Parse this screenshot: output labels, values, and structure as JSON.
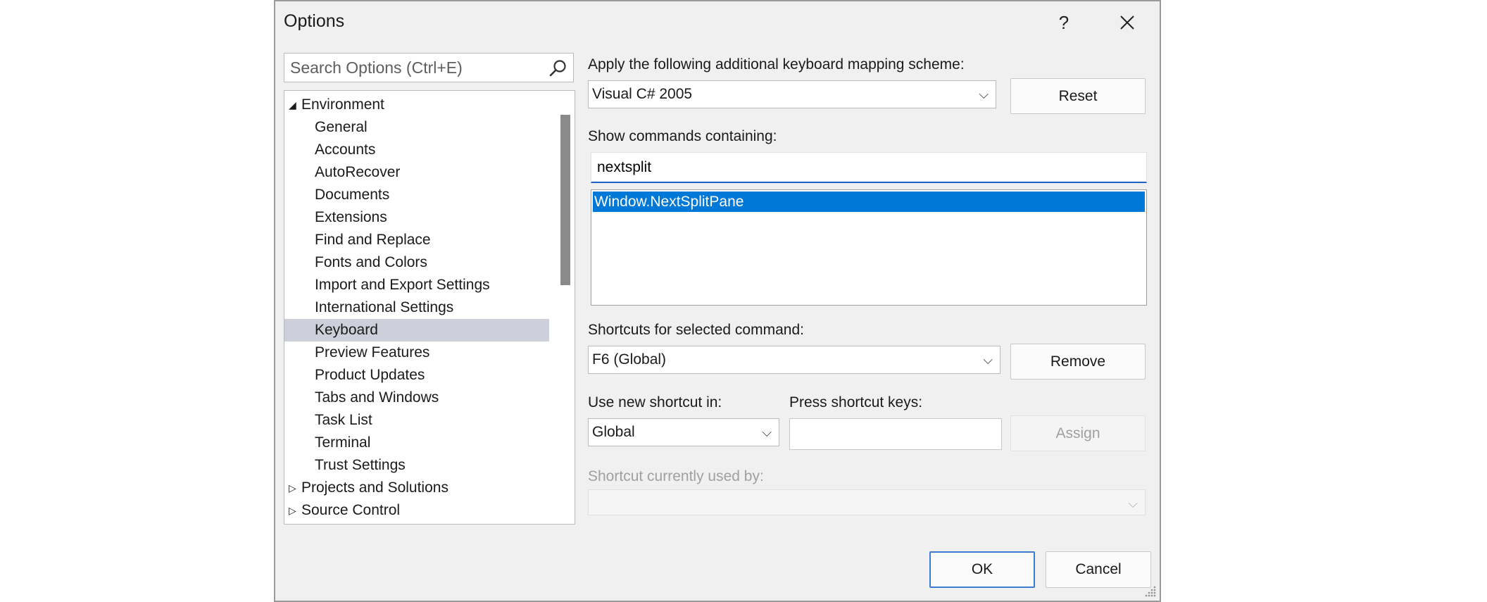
{
  "window": {
    "title": "Options",
    "help_label": "?",
    "close_label": "✕"
  },
  "search": {
    "placeholder": "Search Options (Ctrl+E)"
  },
  "tree": {
    "items": [
      {
        "label": "Environment",
        "level": 0,
        "expanded": true
      },
      {
        "label": "General",
        "level": 1
      },
      {
        "label": "Accounts",
        "level": 1
      },
      {
        "label": "AutoRecover",
        "level": 1
      },
      {
        "label": "Documents",
        "level": 1
      },
      {
        "label": "Extensions",
        "level": 1
      },
      {
        "label": "Find and Replace",
        "level": 1
      },
      {
        "label": "Fonts and Colors",
        "level": 1
      },
      {
        "label": "Import and Export Settings",
        "level": 1
      },
      {
        "label": "International Settings",
        "level": 1
      },
      {
        "label": "Keyboard",
        "level": 1,
        "selected": true
      },
      {
        "label": "Preview Features",
        "level": 1
      },
      {
        "label": "Product Updates",
        "level": 1
      },
      {
        "label": "Tabs and Windows",
        "level": 1
      },
      {
        "label": "Task List",
        "level": 1
      },
      {
        "label": "Terminal",
        "level": 1
      },
      {
        "label": "Trust Settings",
        "level": 1
      },
      {
        "label": "Projects and Solutions",
        "level": 0,
        "expanded": false
      },
      {
        "label": "Source Control",
        "level": 0,
        "expanded": false
      }
    ]
  },
  "keyboard": {
    "mapping_label": "Apply the following additional keyboard mapping scheme:",
    "mapping_value": "Visual C# 2005",
    "reset_label": "Reset",
    "show_commands_label": "Show commands containing:",
    "commands_filter": "nextsplit",
    "commands": [
      "Window.NextSplitPane"
    ],
    "shortcuts_label": "Shortcuts for selected command:",
    "shortcuts_value": "F6 (Global)",
    "remove_label": "Remove",
    "use_in_label": "Use new shortcut in:",
    "use_in_value": "Global",
    "press_keys_label": "Press shortcut keys:",
    "press_keys_value": "",
    "assign_label": "Assign",
    "used_by_label": "Shortcut currently used by:",
    "used_by_value": ""
  },
  "footer": {
    "ok_label": "OK",
    "cancel_label": "Cancel"
  },
  "colors": {
    "selection": "#0078d7",
    "tree_selection": "#cdd0da",
    "focus_underline": "#1e63c9",
    "dialog_background": "#f0f0f0"
  }
}
